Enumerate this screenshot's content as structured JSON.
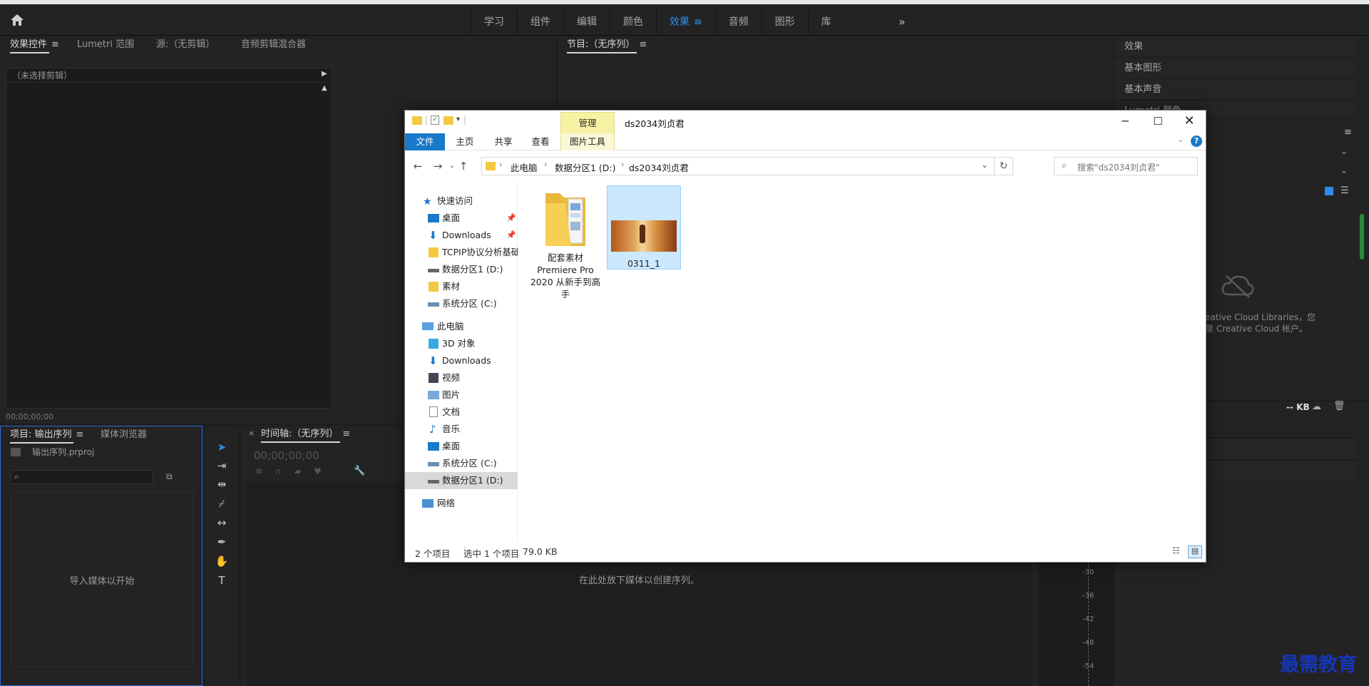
{
  "workspace": {
    "tabs": [
      "学习",
      "组件",
      "编辑",
      "颜色",
      "效果",
      "音频",
      "图形",
      "库"
    ],
    "active": "效果",
    "more_icon": "double-chevron-icon"
  },
  "effects_panel": {
    "tabs": [
      "效果控件",
      "Lumetri 范围",
      "源:（无剪辑）",
      "音频剪辑混合器"
    ],
    "no_clip": "（未选择剪辑）",
    "timecode": "00;00;00;00"
  },
  "program_panel": {
    "title": "节目:（无序列）"
  },
  "right_panel": {
    "items": [
      "效果",
      "基本图形",
      "基本声音",
      "Lumetri 颜色"
    ],
    "cc_text_1": "eative Cloud Libraries，您",
    "cc_text_2": "录 Creative Cloud 帐户。",
    "size": "-- KB"
  },
  "project_panel": {
    "tabs": [
      "项目: 输出序列",
      "媒体浏览器"
    ],
    "file": "输出序列.prproj",
    "empty_text": "导入媒体以开始"
  },
  "timeline_panel": {
    "title": "时间轴:（无序列）",
    "timecode": "00;00;00;00",
    "drop_text": "在此处放下媒体以创建序列。"
  },
  "meter": {
    "ticks": [
      "-30",
      "-36",
      "-42",
      "-48",
      "-54"
    ]
  },
  "explorer": {
    "title": "ds2034刘贞君",
    "ribbon": {
      "file": "文件",
      "home": "主页",
      "share": "共享",
      "view": "查看",
      "manage": "管理",
      "picture_tools": "图片工具"
    },
    "address": {
      "this_pc": "此电脑",
      "drive": "数据分区1 (D:)",
      "folder": "ds2034刘贞君"
    },
    "search_placeholder": "搜索\"ds2034刘贞君\"",
    "nav": {
      "quick_access": "快速访问",
      "qa_items": [
        "桌面",
        "Downloads",
        "TCPIP协议分析基础",
        "数据分区1 (D:)",
        "素材",
        "系统分区 (C:)"
      ],
      "this_pc": "此电脑",
      "pc_items": [
        "3D 对象",
        "Downloads",
        "视频",
        "图片",
        "文档",
        "音乐",
        "桌面",
        "系统分区 (C:)",
        "数据分区1 (D:)"
      ],
      "network": "网络"
    },
    "items": [
      {
        "name": "配套素材 Premiere Pro 2020 从新手到高手",
        "type": "folder"
      },
      {
        "name": "0311_1",
        "type": "image"
      }
    ],
    "status": {
      "count": "2 个项目",
      "selected": "选中 1 个项目",
      "size": "79.0 KB"
    }
  },
  "watermark": "最需教育"
}
